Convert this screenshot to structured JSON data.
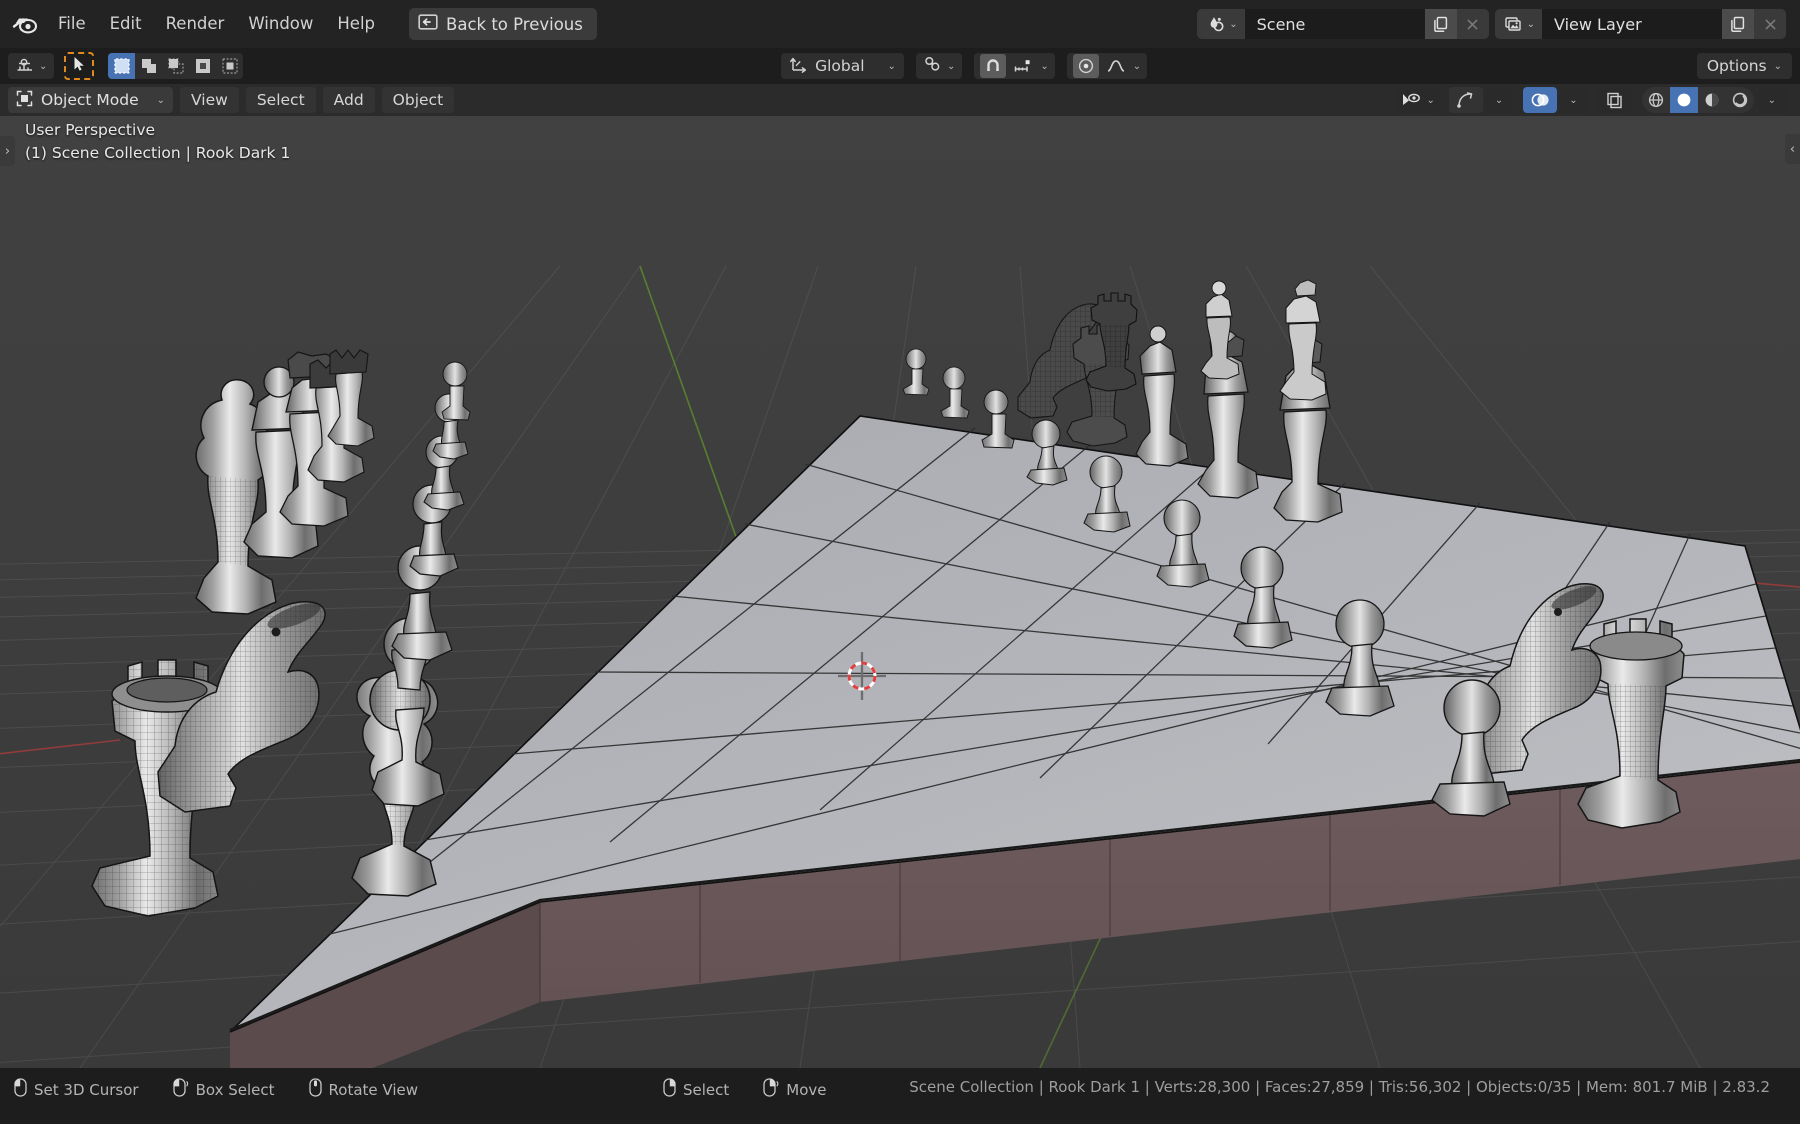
{
  "app": {
    "logo_icon": "blender-logo-icon",
    "version": "2.83.2"
  },
  "menubar": {
    "items": [
      {
        "label": "File",
        "name": "menu-file"
      },
      {
        "label": "Edit",
        "name": "menu-edit"
      },
      {
        "label": "Render",
        "name": "menu-render"
      },
      {
        "label": "Window",
        "name": "menu-window"
      },
      {
        "label": "Help",
        "name": "menu-help"
      }
    ],
    "back_button": {
      "label": "Back to Previous",
      "icon": "back-arrow-screen-icon"
    },
    "scene": {
      "browse_icon": "scene-browse-icon",
      "name": "Scene",
      "new_icon": "copy-new-icon",
      "unlink_icon": "close-x-icon"
    },
    "view_layer": {
      "browse_icon": "view-layer-browse-icon",
      "name": "View Layer",
      "new_icon": "copy-new-icon",
      "unlink_icon": "close-x-icon"
    }
  },
  "toolheader": {
    "editor_type_icon": "editor-type-3dview-icon",
    "cursor_tool_icon": "cursor-arrow-icon",
    "select_modes": [
      {
        "icon": "select-set-icon",
        "active": true
      },
      {
        "icon": "select-extend-icon",
        "active": false
      },
      {
        "icon": "select-subtract-icon",
        "active": false
      },
      {
        "icon": "select-invert-icon",
        "active": false
      },
      {
        "icon": "select-intersect-icon",
        "active": false
      }
    ],
    "transform_orientation": {
      "icon": "orientation-axes-icon",
      "label": "Global",
      "chevron": "chevron-down-icon"
    },
    "pivot_point": {
      "icon": "pivot-median-icon",
      "chevron": "chevron-down-icon"
    },
    "snap_magnet": {
      "icon": "magnet-icon",
      "active": true
    },
    "snap_to": {
      "icon": "snap-increment-icon",
      "chevron": "chevron-down-icon"
    },
    "proportional_edit": {
      "icon": "proportional-edit-icon",
      "active": true
    },
    "falloff": {
      "icon": "falloff-smooth-icon",
      "chevron": "chevron-down-icon"
    },
    "options": {
      "label": "Options",
      "chevron": "chevron-down-icon"
    }
  },
  "viewport_header": {
    "mode": {
      "icon": "object-mode-icon",
      "label": "Object Mode",
      "chevron": "chevron-down-icon"
    },
    "menus": [
      {
        "label": "View",
        "name": "vp-menu-view"
      },
      {
        "label": "Select",
        "name": "vp-menu-select"
      },
      {
        "label": "Add",
        "name": "vp-menu-add"
      },
      {
        "label": "Object",
        "name": "vp-menu-object"
      }
    ],
    "visibility": {
      "icon": "object-visibility-icon",
      "chevron": "chevron-down-icon"
    },
    "gizmo": {
      "icon": "gizmo-icon",
      "chevron": "chevron-down-icon"
    },
    "overlays": {
      "icon": "overlays-icon",
      "active": true,
      "chevron": "chevron-down-icon"
    },
    "xray": {
      "icon": "xray-toggle-icon",
      "active": false
    },
    "shading": [
      {
        "icon": "shading-wireframe-icon",
        "active": false
      },
      {
        "icon": "shading-solid-icon",
        "active": true
      },
      {
        "icon": "shading-material-preview-icon",
        "active": false
      },
      {
        "icon": "shading-rendered-icon",
        "active": false
      }
    ],
    "shading_chevron": "chevron-down-icon"
  },
  "viewport": {
    "perspective_label": "User Perspective",
    "collection_label": "(1) Scene Collection | Rook Dark 1",
    "left_tab_icon": "panel-expand-right-icon",
    "right_tab_icon": "panel-expand-left-icon",
    "cursor_3d_icon": "cursor-3d-icon",
    "colors": {
      "background": "#3d3d3d",
      "board_top": "#b0b2b7",
      "board_side": "#6b585a",
      "piece_light": "#e8e8e8",
      "piece_mid": "#9a9a9a",
      "piece_dark": "#5a5a5a",
      "wire": "#1a1a1a",
      "axis_x": "#9b3b3b",
      "axis_y": "#5d8a2f",
      "cursor_red": "#e14040"
    },
    "scene_description": "Chess set on an 8x8 board in solid shading with wireframe overlay, viewed in user perspective"
  },
  "statusbar": {
    "hints": [
      {
        "icon": "mouse-left-icon",
        "label": "Set 3D Cursor"
      },
      {
        "icon": "mouse-left-drag-icon",
        "label": "Box Select"
      },
      {
        "icon": "mouse-middle-icon",
        "label": "Rotate View"
      },
      {
        "icon": "mouse-right-icon",
        "label": "Select"
      },
      {
        "icon": "mouse-right-drag-icon",
        "label": "Move"
      }
    ],
    "scene_stats": "Scene Collection | Rook Dark 1 | Verts:28,300 | Faces:27,859 | Tris:56,302 | Objects:0/35 | Mem: 801.7 MiB | 2.83.2"
  }
}
